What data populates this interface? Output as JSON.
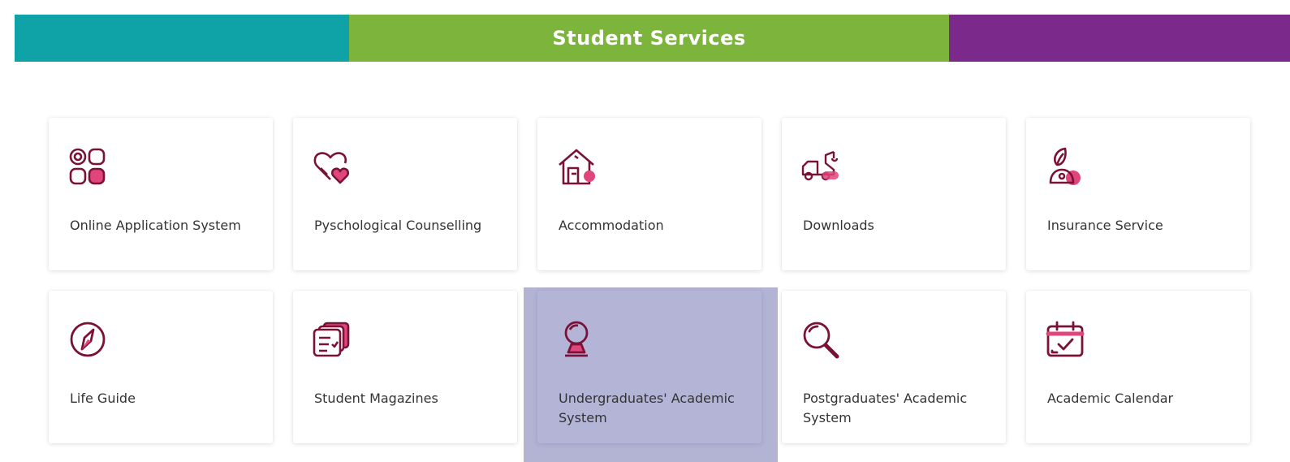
{
  "header": {
    "title": "Student Services",
    "colors": {
      "teal": "#0fa3a8",
      "green": "#7db53c",
      "purple": "#7b2a8c"
    }
  },
  "icon_colors": {
    "stroke": "#7a1237",
    "accent": "#e0457b"
  },
  "services": [
    {
      "label": "Online Application System",
      "icon": "apps-grid-icon",
      "active": false
    },
    {
      "label": "Pyschological Counselling",
      "icon": "hearts-icon",
      "active": false
    },
    {
      "label": "Accommodation",
      "icon": "house-icon",
      "active": false
    },
    {
      "label": "Downloads",
      "icon": "tow-truck-icon",
      "active": false
    },
    {
      "label": "Insurance Service",
      "icon": "person-leaf-icon",
      "active": false
    },
    {
      "label": "Life Guide",
      "icon": "compass-icon",
      "active": false
    },
    {
      "label": "Student Magazines",
      "icon": "magazines-icon",
      "active": false
    },
    {
      "label": "Undergraduates' Academic System",
      "icon": "globe-icon",
      "active": true
    },
    {
      "label": "Postgraduates' Academic System",
      "icon": "magnifier-icon",
      "active": false
    },
    {
      "label": "Academic Calendar",
      "icon": "calendar-icon",
      "active": false
    }
  ]
}
